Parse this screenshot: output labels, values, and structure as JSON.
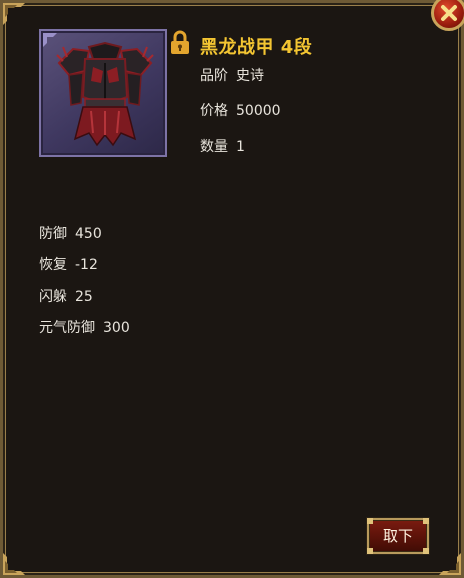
{
  "item": {
    "name": "黑龙战甲 4段",
    "rarity_label": "品阶",
    "rarity_value": "史诗",
    "price_label": "价格",
    "price_value": "50000",
    "quantity_label": "数量",
    "quantity_value": "1",
    "icon": "black-dragon-armor-icon",
    "locked": true
  },
  "stats": [
    {
      "label": "防御",
      "value": "450"
    },
    {
      "label": "恢复",
      "value": "-12"
    },
    {
      "label": "闪躲",
      "value": "25"
    },
    {
      "label": "元气防御",
      "value": "300"
    }
  ],
  "actions": {
    "unequip_label": "取下"
  },
  "colors": {
    "name": "#f3c532",
    "text": "#e8e4dc",
    "panel_bg": "#1b1612",
    "border_gold": "#9a7f4b",
    "button_red": "#5b1209",
    "close_red": "#9a1c0e"
  }
}
